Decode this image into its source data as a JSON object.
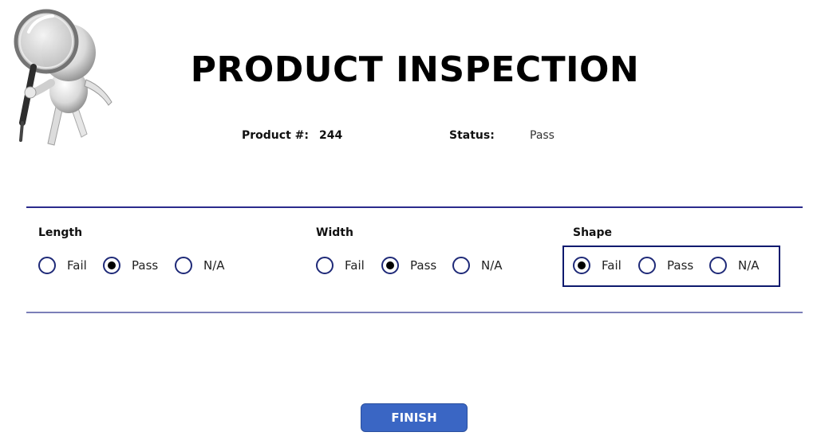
{
  "page": {
    "title": "PRODUCT INSPECTION"
  },
  "info": {
    "product_label": "Product #:",
    "product_value": "244",
    "status_label": "Status:",
    "status_value": "Pass"
  },
  "groups": [
    {
      "label": "Length",
      "options": [
        {
          "label": "Fail",
          "checked": false
        },
        {
          "label": "Pass",
          "checked": true
        },
        {
          "label": "N/A",
          "checked": false
        }
      ]
    },
    {
      "label": "Width",
      "options": [
        {
          "label": "Fail",
          "checked": false
        },
        {
          "label": "Pass",
          "checked": true
        },
        {
          "label": "N/A",
          "checked": false
        }
      ]
    },
    {
      "label": "Shape",
      "options": [
        {
          "label": "Fail",
          "checked": true
        },
        {
          "label": "Pass",
          "checked": false
        },
        {
          "label": "N/A",
          "checked": false
        }
      ]
    }
  ],
  "actions": {
    "finish_label": "FINISH"
  },
  "colors": {
    "divider": "#2b2b8c",
    "radio_border": "#1f2a78",
    "focus_border": "#0e1a6e",
    "button_bg": "#3a66c4"
  },
  "icons": {
    "mascot": "magnifying-glass-mascot-icon"
  }
}
